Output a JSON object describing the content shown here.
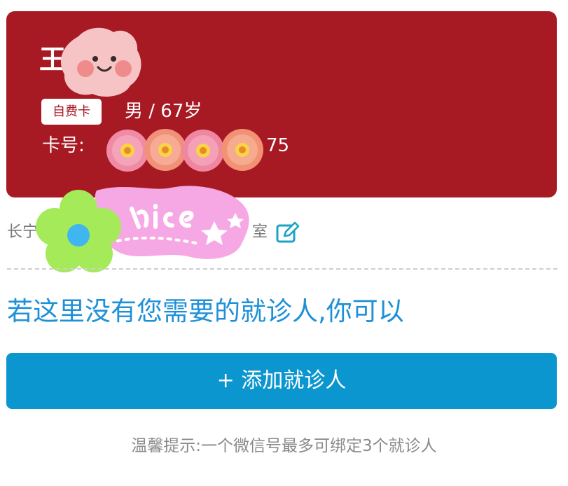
{
  "patient_card": {
    "name_visible": "王",
    "card_type": "自费卡",
    "gender_age": "男 / 67岁",
    "card_number_label": "卡号:",
    "card_number_tail": "75",
    "background_color": "#a71a24"
  },
  "address": {
    "prefix": "长宁",
    "suffix": "室",
    "edit_icon": "edit-icon"
  },
  "stickers": {
    "name_cover": "blush-face-sticker",
    "card_number_cover": "flower-stickers",
    "address_cover": "nice-sticker"
  },
  "prompt": {
    "text": "若这里没有您需要的就诊人,你可以"
  },
  "add_button": {
    "label": "+ 添加就诊人",
    "color": "#0b96cf"
  },
  "tip": {
    "text": "温馨提示:一个微信号最多可绑定3个就诊人"
  }
}
